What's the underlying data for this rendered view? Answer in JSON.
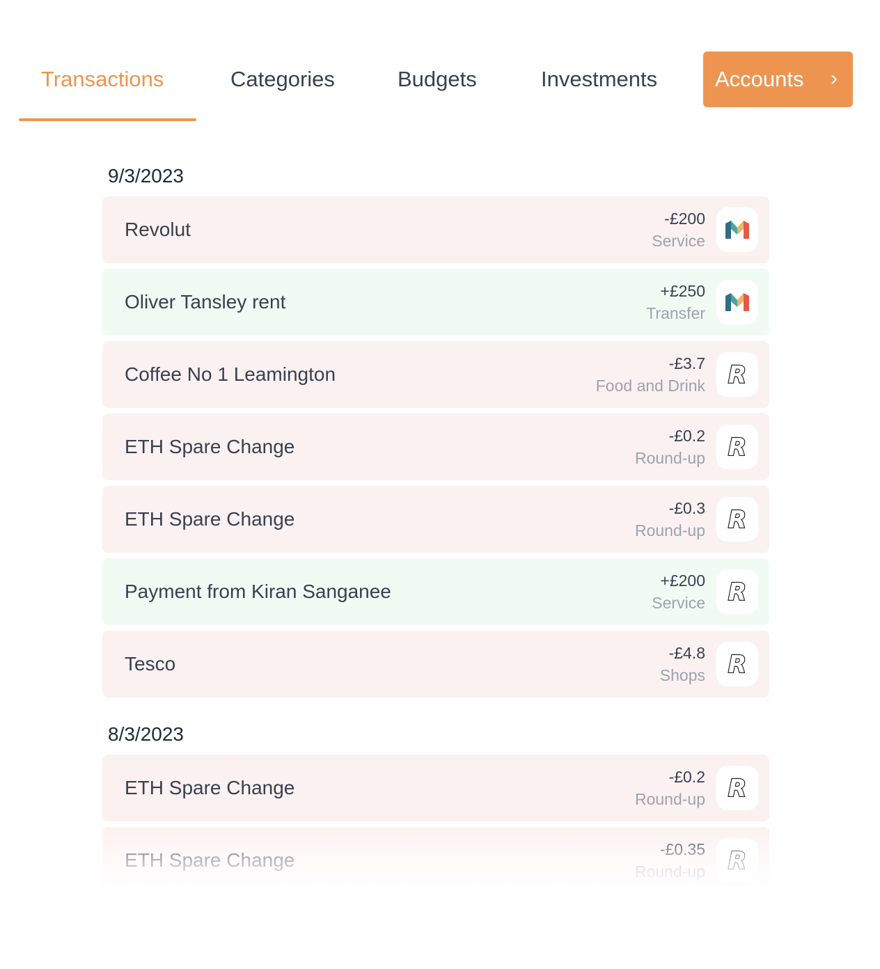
{
  "tabs": {
    "transactions": "Transactions",
    "categories": "Categories",
    "budgets": "Budgets",
    "investments": "Investments",
    "accounts": "Accounts",
    "accounts_icon": "chevron-right-icon"
  },
  "colors": {
    "accent": "#ED9550",
    "debit_bg": "#FCF1F1",
    "credit_bg": "#F0FBF4",
    "secondary_text": "#9CA3AF"
  },
  "groups": [
    {
      "date": "9/3/2023",
      "transactions": [
        {
          "name": "Revolut",
          "amount": "-£200",
          "category": "Service",
          "type": "debit",
          "logo": "monzo-logo"
        },
        {
          "name": "Oliver Tansley rent",
          "amount": "+£250",
          "category": "Transfer",
          "type": "credit",
          "logo": "monzo-logo"
        },
        {
          "name": "Coffee No 1 Leamington",
          "amount": "-£3.7",
          "category": "Food and Drink",
          "type": "debit",
          "logo": "revolut-logo"
        },
        {
          "name": "ETH Spare Change",
          "amount": "-£0.2",
          "category": "Round-up",
          "type": "debit",
          "logo": "revolut-logo"
        },
        {
          "name": "ETH Spare Change",
          "amount": "-£0.3",
          "category": "Round-up",
          "type": "debit",
          "logo": "revolut-logo"
        },
        {
          "name": "Payment from Kiran Sanganee",
          "amount": "+£200",
          "category": "Service",
          "type": "credit",
          "logo": "revolut-logo"
        },
        {
          "name": "Tesco",
          "amount": "-£4.8",
          "category": "Shops",
          "type": "debit",
          "logo": "revolut-logo"
        }
      ]
    },
    {
      "date": "8/3/2023",
      "transactions": [
        {
          "name": "ETH Spare Change",
          "amount": "-£0.2",
          "category": "Round-up",
          "type": "debit",
          "logo": "revolut-logo"
        },
        {
          "name": "ETH Spare Change",
          "amount": "-£0.35",
          "category": "Round-up",
          "type": "debit",
          "logo": "revolut-logo"
        }
      ]
    }
  ]
}
